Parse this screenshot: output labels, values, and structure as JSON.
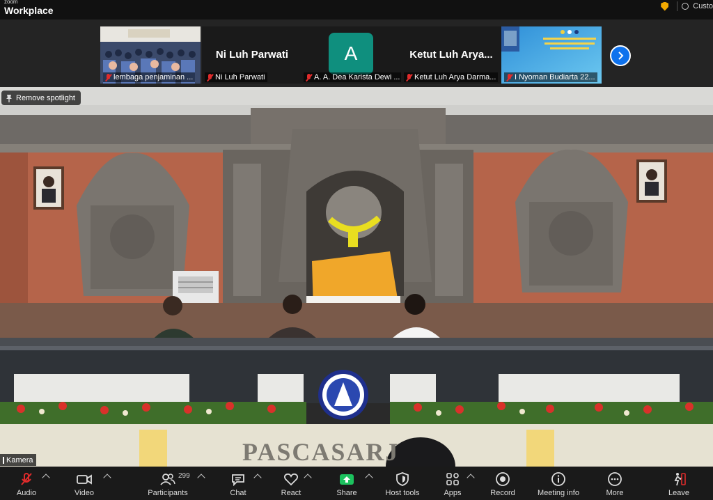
{
  "window": {
    "brand_small": "zoom",
    "brand_big": "Workplace",
    "right_label": "Custo"
  },
  "strip": {
    "tiles": [
      {
        "label": "lembaga penjaminan ..."
      },
      {
        "name": "Ni Luh Parwati",
        "label": "Ni Luh Parwati"
      },
      {
        "avatar_letter": "A",
        "label": "A. A. Dea Karista Dewi ..."
      },
      {
        "name": "Ketut Luh Arya...",
        "label": "Ketut Luh Arya Darma..."
      },
      {
        "label": "I Nyoman Budiarta 22..."
      }
    ]
  },
  "main": {
    "spotlight_label": "Remove spotlight",
    "camera_label": "Kamera",
    "banner_text": "PASCASARJ"
  },
  "toolbar": {
    "audio": "Audio",
    "video": "Video",
    "participants": "Participants",
    "participants_count": "299",
    "chat": "Chat",
    "react": "React",
    "share": "Share",
    "host_tools": "Host tools",
    "apps": "Apps",
    "record": "Record",
    "meeting_info": "Meeting info",
    "more": "More",
    "leave": "Leave"
  },
  "colors": {
    "accent_blue": "#0e72ed",
    "share_green": "#1cc25e",
    "mute_red": "#e02b2b",
    "avatar_teal": "#0f8f7e",
    "leave_red": "#e02b2b"
  }
}
